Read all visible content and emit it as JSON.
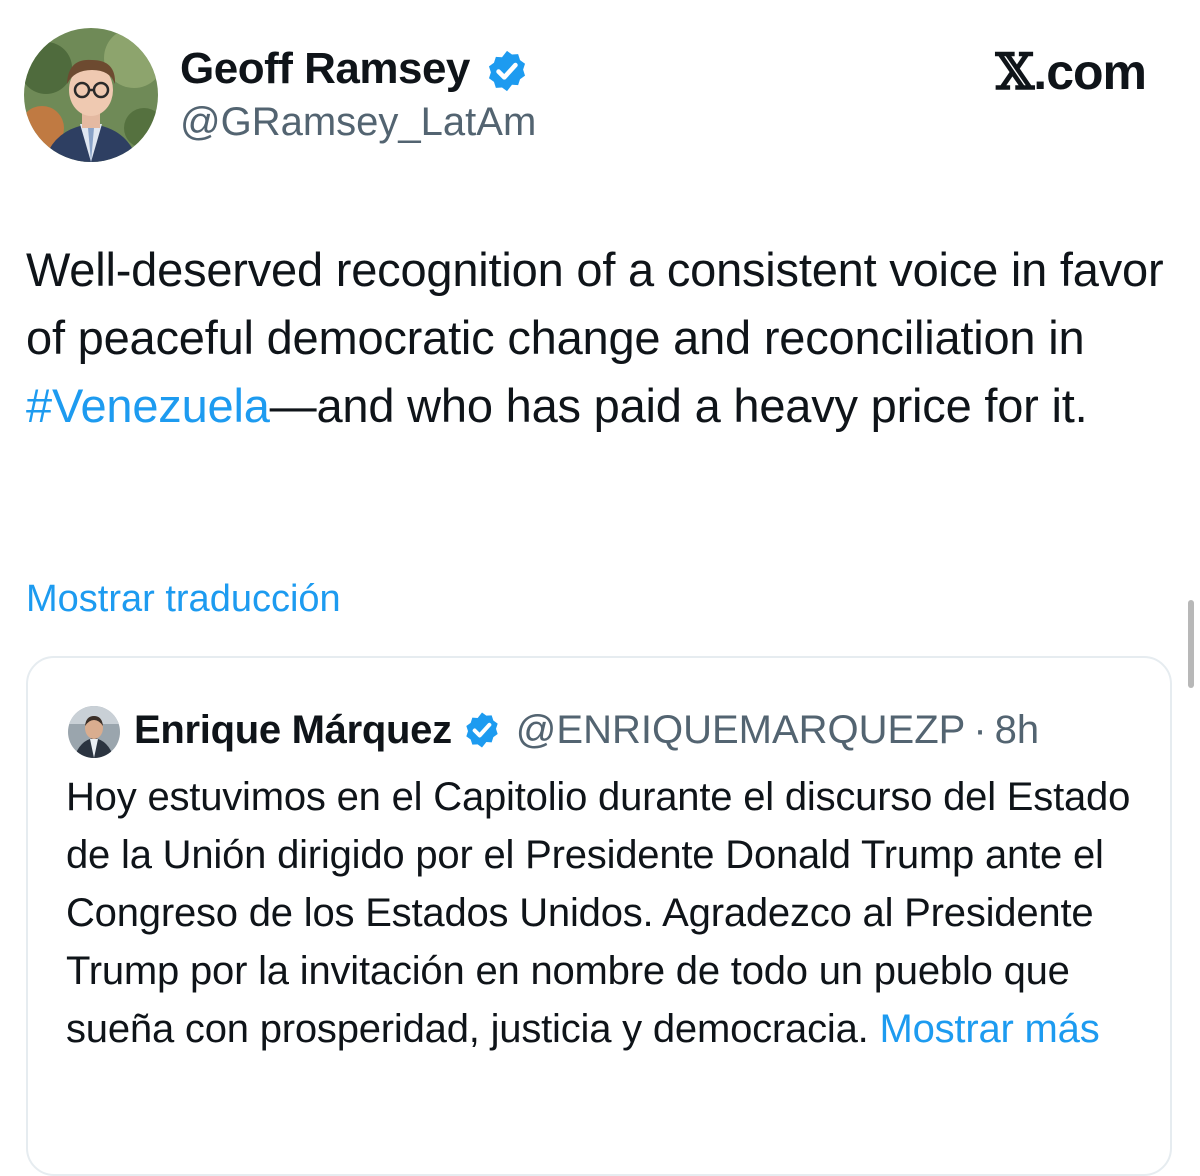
{
  "author": {
    "display_name": "Geoff Ramsey",
    "handle": "@GRamsey_LatAm"
  },
  "site": {
    "logo_glyph": "𝕏",
    "logo_suffix": ".com"
  },
  "tweet": {
    "text_before": "Well-deserved recognition of a consistent voice in favor of peaceful democratic change and reconciliation in ",
    "hashtag": "#Venezuela",
    "text_after": "—and who has paid a heavy price for it."
  },
  "translation_link": "Mostrar traducción",
  "quote": {
    "display_name": "Enrique Márquez",
    "handle": "@ENRIQUEMARQUEZP",
    "separator": "·",
    "time": "8h",
    "text": "Hoy estuvimos en el Capitolio durante el discurso del Estado de la Unión dirigido por el Presidente Donald Trump ante el Congreso de los Estados Unidos. Agradezco al Presidente Trump por la invitación en nombre de todo un pueblo que sueña con prosperidad, justicia y democracia. ",
    "show_more": "Mostrar más"
  },
  "colors": {
    "accent": "#1d9bf0",
    "text": "#0f1419",
    "secondary": "#536471",
    "border": "#e6ecf0"
  },
  "icons": {
    "verified": "verified-badge-icon",
    "logo": "x-logo-icon"
  }
}
